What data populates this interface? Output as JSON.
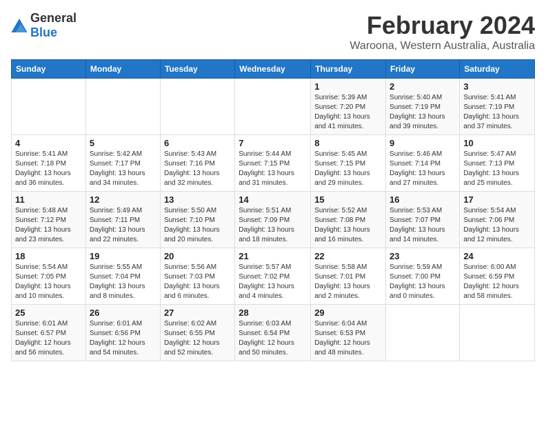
{
  "logo": {
    "general": "General",
    "blue": "Blue"
  },
  "title": "February 2024",
  "subtitle": "Waroona, Western Australia, Australia",
  "days_header": [
    "Sunday",
    "Monday",
    "Tuesday",
    "Wednesday",
    "Thursday",
    "Friday",
    "Saturday"
  ],
  "weeks": [
    [
      {
        "day": "",
        "info": ""
      },
      {
        "day": "",
        "info": ""
      },
      {
        "day": "",
        "info": ""
      },
      {
        "day": "",
        "info": ""
      },
      {
        "day": "1",
        "info": "Sunrise: 5:39 AM\nSunset: 7:20 PM\nDaylight: 13 hours\nand 41 minutes."
      },
      {
        "day": "2",
        "info": "Sunrise: 5:40 AM\nSunset: 7:19 PM\nDaylight: 13 hours\nand 39 minutes."
      },
      {
        "day": "3",
        "info": "Sunrise: 5:41 AM\nSunset: 7:19 PM\nDaylight: 13 hours\nand 37 minutes."
      }
    ],
    [
      {
        "day": "4",
        "info": "Sunrise: 5:41 AM\nSunset: 7:18 PM\nDaylight: 13 hours\nand 36 minutes."
      },
      {
        "day": "5",
        "info": "Sunrise: 5:42 AM\nSunset: 7:17 PM\nDaylight: 13 hours\nand 34 minutes."
      },
      {
        "day": "6",
        "info": "Sunrise: 5:43 AM\nSunset: 7:16 PM\nDaylight: 13 hours\nand 32 minutes."
      },
      {
        "day": "7",
        "info": "Sunrise: 5:44 AM\nSunset: 7:15 PM\nDaylight: 13 hours\nand 31 minutes."
      },
      {
        "day": "8",
        "info": "Sunrise: 5:45 AM\nSunset: 7:15 PM\nDaylight: 13 hours\nand 29 minutes."
      },
      {
        "day": "9",
        "info": "Sunrise: 5:46 AM\nSunset: 7:14 PM\nDaylight: 13 hours\nand 27 minutes."
      },
      {
        "day": "10",
        "info": "Sunrise: 5:47 AM\nSunset: 7:13 PM\nDaylight: 13 hours\nand 25 minutes."
      }
    ],
    [
      {
        "day": "11",
        "info": "Sunrise: 5:48 AM\nSunset: 7:12 PM\nDaylight: 13 hours\nand 23 minutes."
      },
      {
        "day": "12",
        "info": "Sunrise: 5:49 AM\nSunset: 7:11 PM\nDaylight: 13 hours\nand 22 minutes."
      },
      {
        "day": "13",
        "info": "Sunrise: 5:50 AM\nSunset: 7:10 PM\nDaylight: 13 hours\nand 20 minutes."
      },
      {
        "day": "14",
        "info": "Sunrise: 5:51 AM\nSunset: 7:09 PM\nDaylight: 13 hours\nand 18 minutes."
      },
      {
        "day": "15",
        "info": "Sunrise: 5:52 AM\nSunset: 7:08 PM\nDaylight: 13 hours\nand 16 minutes."
      },
      {
        "day": "16",
        "info": "Sunrise: 5:53 AM\nSunset: 7:07 PM\nDaylight: 13 hours\nand 14 minutes."
      },
      {
        "day": "17",
        "info": "Sunrise: 5:54 AM\nSunset: 7:06 PM\nDaylight: 13 hours\nand 12 minutes."
      }
    ],
    [
      {
        "day": "18",
        "info": "Sunrise: 5:54 AM\nSunset: 7:05 PM\nDaylight: 13 hours\nand 10 minutes."
      },
      {
        "day": "19",
        "info": "Sunrise: 5:55 AM\nSunset: 7:04 PM\nDaylight: 13 hours\nand 8 minutes."
      },
      {
        "day": "20",
        "info": "Sunrise: 5:56 AM\nSunset: 7:03 PM\nDaylight: 13 hours\nand 6 minutes."
      },
      {
        "day": "21",
        "info": "Sunrise: 5:57 AM\nSunset: 7:02 PM\nDaylight: 13 hours\nand 4 minutes."
      },
      {
        "day": "22",
        "info": "Sunrise: 5:58 AM\nSunset: 7:01 PM\nDaylight: 13 hours\nand 2 minutes."
      },
      {
        "day": "23",
        "info": "Sunrise: 5:59 AM\nSunset: 7:00 PM\nDaylight: 13 hours\nand 0 minutes."
      },
      {
        "day": "24",
        "info": "Sunrise: 6:00 AM\nSunset: 6:59 PM\nDaylight: 12 hours\nand 58 minutes."
      }
    ],
    [
      {
        "day": "25",
        "info": "Sunrise: 6:01 AM\nSunset: 6:57 PM\nDaylight: 12 hours\nand 56 minutes."
      },
      {
        "day": "26",
        "info": "Sunrise: 6:01 AM\nSunset: 6:56 PM\nDaylight: 12 hours\nand 54 minutes."
      },
      {
        "day": "27",
        "info": "Sunrise: 6:02 AM\nSunset: 6:55 PM\nDaylight: 12 hours\nand 52 minutes."
      },
      {
        "day": "28",
        "info": "Sunrise: 6:03 AM\nSunset: 6:54 PM\nDaylight: 12 hours\nand 50 minutes."
      },
      {
        "day": "29",
        "info": "Sunrise: 6:04 AM\nSunset: 6:53 PM\nDaylight: 12 hours\nand 48 minutes."
      },
      {
        "day": "",
        "info": ""
      },
      {
        "day": "",
        "info": ""
      }
    ]
  ]
}
